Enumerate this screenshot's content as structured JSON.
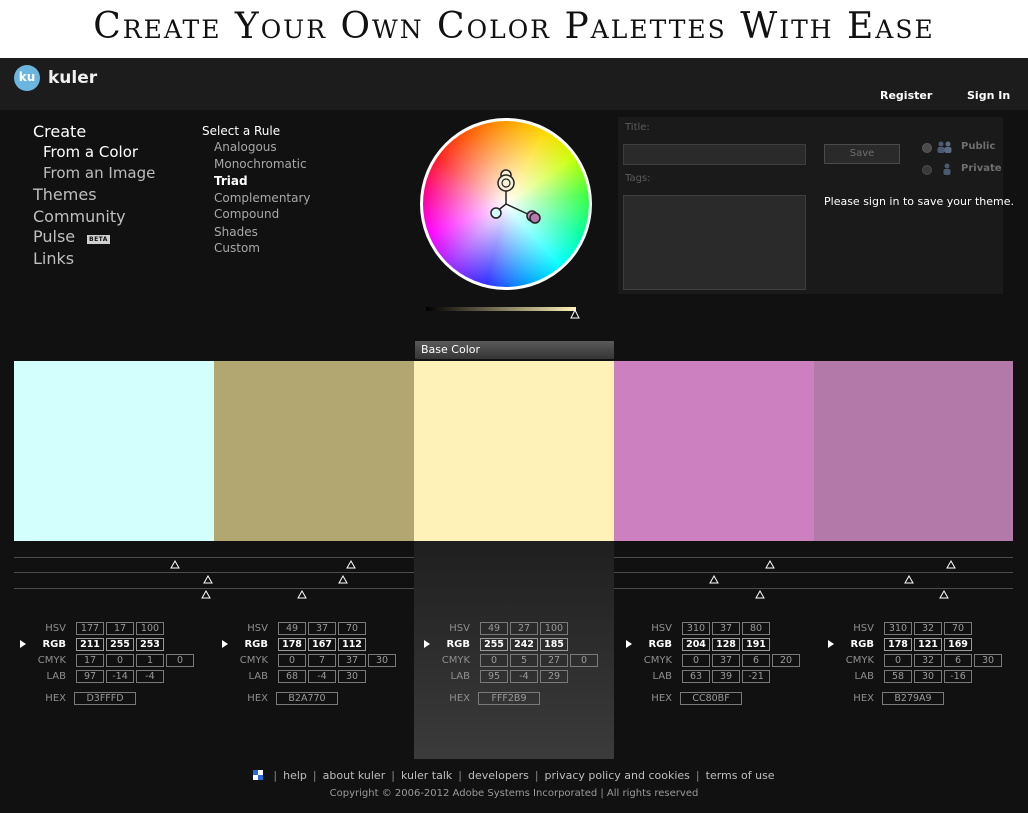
{
  "banner": {
    "title": "Create Your Own Color Palettes With Ease"
  },
  "header": {
    "logo_badge": "ku",
    "app_name": "kuler",
    "register": "Register",
    "sign_in": "Sign In"
  },
  "nav": {
    "create": "Create",
    "from_color": "From a Color",
    "from_image": "From an Image",
    "themes": "Themes",
    "community": "Community",
    "pulse": "Pulse",
    "beta": "BETA",
    "links": "Links"
  },
  "rules": {
    "title": "Select a Rule",
    "items": [
      "Analogous",
      "Monochromatic",
      "Triad",
      "Complementary",
      "Compound",
      "Shades",
      "Custom"
    ],
    "selected": "Triad"
  },
  "save_panel": {
    "title_label": "Title:",
    "tags_label": "Tags:",
    "save_button": "Save",
    "public_label": "Public",
    "private_label": "Private",
    "signin_message": "Please sign in to save your theme."
  },
  "base_color_label": "Base Color",
  "labels": {
    "hsv": "HSV",
    "rgb": "RGB",
    "cmyk": "CMYK",
    "lab": "LAB",
    "hex": "HEX"
  },
  "swatches": [
    {
      "color": "#D3FFFD",
      "hsv": [
        "177",
        "17",
        "100"
      ],
      "rgb": [
        "211",
        "255",
        "253"
      ],
      "cmyk": [
        "17",
        "0",
        "1",
        "0"
      ],
      "lab": [
        "97",
        "-14",
        "-4"
      ],
      "hex": "D3FFFD"
    },
    {
      "color": "#B2A770",
      "hsv": [
        "49",
        "37",
        "70"
      ],
      "rgb": [
        "178",
        "167",
        "112"
      ],
      "cmyk": [
        "0",
        "7",
        "37",
        "30"
      ],
      "lab": [
        "68",
        "-4",
        "30"
      ],
      "hex": "B2A770"
    },
    {
      "color": "#FFF2B9",
      "hsv": [
        "49",
        "27",
        "100"
      ],
      "rgb": [
        "255",
        "242",
        "185"
      ],
      "cmyk": [
        "0",
        "5",
        "27",
        "0"
      ],
      "lab": [
        "95",
        "-4",
        "29"
      ],
      "hex": "FFF2B9"
    },
    {
      "color": "#CC80BF",
      "hsv": [
        "310",
        "37",
        "80"
      ],
      "rgb": [
        "204",
        "128",
        "191"
      ],
      "cmyk": [
        "0",
        "37",
        "6",
        "20"
      ],
      "lab": [
        "63",
        "39",
        "-21"
      ],
      "hex": "CC80BF"
    },
    {
      "color": "#B279A9",
      "hsv": [
        "310",
        "32",
        "70"
      ],
      "rgb": [
        "178",
        "121",
        "169"
      ],
      "cmyk": [
        "0",
        "32",
        "6",
        "30"
      ],
      "lab": [
        "58",
        "30",
        "-16"
      ],
      "hex": "B279A9"
    }
  ],
  "footer": {
    "links": [
      "help",
      "about kuler",
      "kuler talk",
      "developers",
      "privacy policy and cookies",
      "terms of use"
    ],
    "copyright": "Copyright © 2006-2012 Adobe Systems Incorporated | All rights reserved"
  }
}
